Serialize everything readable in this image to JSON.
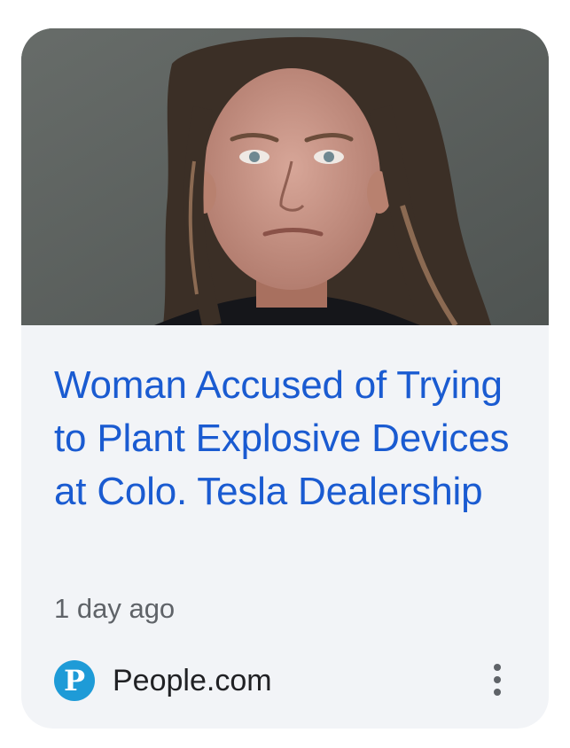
{
  "article": {
    "headline": "Woman Accused of Trying to Plant Explosive Devices at Colo. Tesla Dealership",
    "time_ago": "1 day ago",
    "source": {
      "name": "People.com",
      "logo_letter": "P",
      "logo_color": "#1e9bd7"
    },
    "thumbnail_alt": "mugshot photo",
    "menu_icon": "more-vert-icon"
  },
  "colors": {
    "headline": "#1a5bd1",
    "card_background": "#f2f4f7",
    "meta_text": "#5f6368"
  }
}
